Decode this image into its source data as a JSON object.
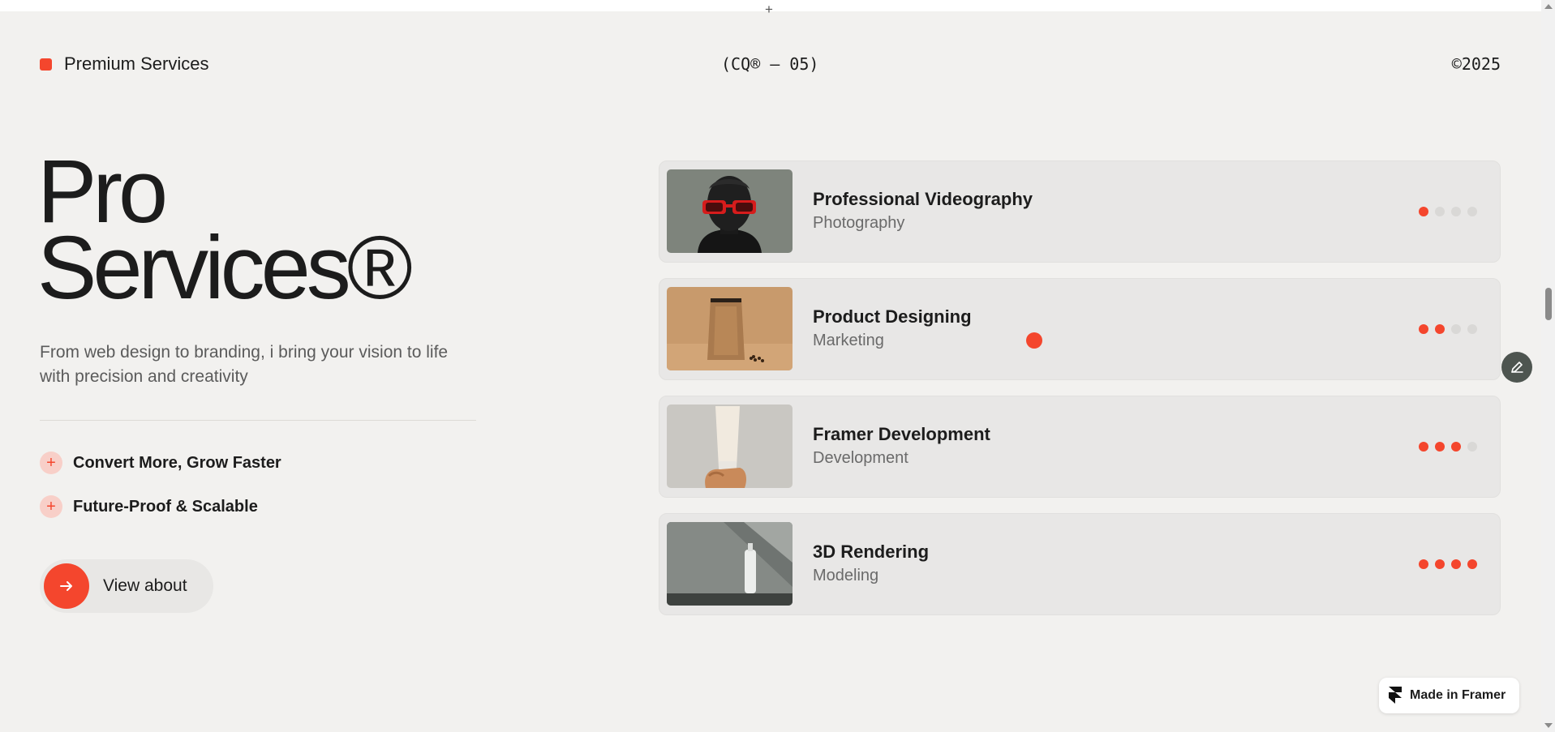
{
  "header": {
    "brand_label": "Premium Services",
    "center_code": "(CQ® — 05)",
    "year": "©2025"
  },
  "hero": {
    "title_line1": "Pro",
    "title_line2": "Services®",
    "description": "From web design to branding, i bring your vision to life with precision and creativity"
  },
  "features": [
    {
      "icon": "plus-icon",
      "label": "Convert More, Grow Faster"
    },
    {
      "icon": "plus-icon",
      "label": "Future-Proof & Scalable"
    }
  ],
  "cta": {
    "label": "View about",
    "icon": "arrow-right-icon"
  },
  "services": [
    {
      "title": "Professional Videography",
      "category": "Photography",
      "level": 1,
      "max_level": 4,
      "image": "portrait-red-glasses"
    },
    {
      "title": "Product Designing",
      "category": "Marketing",
      "level": 2,
      "max_level": 4,
      "image": "kraft-coffee-pouch"
    },
    {
      "title": "Framer Development",
      "category": "Development",
      "level": 3,
      "max_level": 4,
      "image": "hand-holding-tube"
    },
    {
      "title": "3D Rendering",
      "category": "Modeling",
      "level": 4,
      "max_level": 4,
      "image": "white-bottle"
    }
  ],
  "framer_badge": {
    "label": "Made in Framer",
    "icon": "framer-logo-icon"
  },
  "colors": {
    "accent": "#f4462d",
    "background": "#f2f1ef",
    "card": "#e8e7e6",
    "text": "#1c1c1c"
  }
}
